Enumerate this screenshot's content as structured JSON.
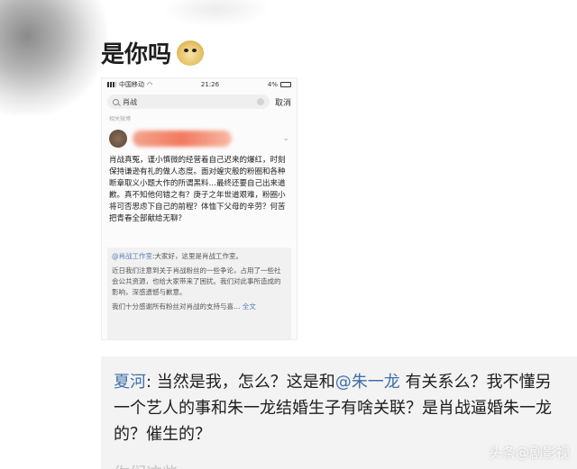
{
  "headline": {
    "text": "是你吗",
    "emoji": "doge-icon"
  },
  "phone": {
    "status": {
      "carrier": "中国移动",
      "time": "21:26",
      "battery": "4%"
    },
    "search": {
      "query": "肖战",
      "cancel": "取消"
    },
    "section_label": "相关微博",
    "post": {
      "text": "肖战真冤，谨小慎微的经营着自己迟来的爆红，时刻保持谦逊有礼的做人态度。面对蝗灾般的粉圈和各种断章取义小题大作的所谓黑料…最终还要自己出来道歉。真不知他何错之有？庚子之年世道艰难，粉圈小将可否思虑下自己的前程？体恤下父母的辛劳？何苦把青春全部献给无聊？"
    },
    "quote": {
      "mention": "@肖战工作室",
      "intro": ":大家好，这里是肖战工作室。",
      "para1": "近日我们注意到关于肖战粉丝的一些争论，占用了一些社会公共资源，也给大家带来了困扰。我们对此事所造成的影响，深感遗憾与歉意。",
      "para2": "我们十分感谢所有粉丝对肖战的支持与喜…",
      "full_text": "全文"
    }
  },
  "comment": {
    "author": "夏河",
    "sep": ": ",
    "part1": "当然是我，怎么？这是和",
    "mention": "@朱一龙",
    "part2": " 有关系么？我不懂另一个艺人的事和朱一龙结婚生子有啥关联？是肖战逼婚朱一龙的？催生的？",
    "faded": "你们这些…",
    "watermark": "头条@剧影视"
  }
}
